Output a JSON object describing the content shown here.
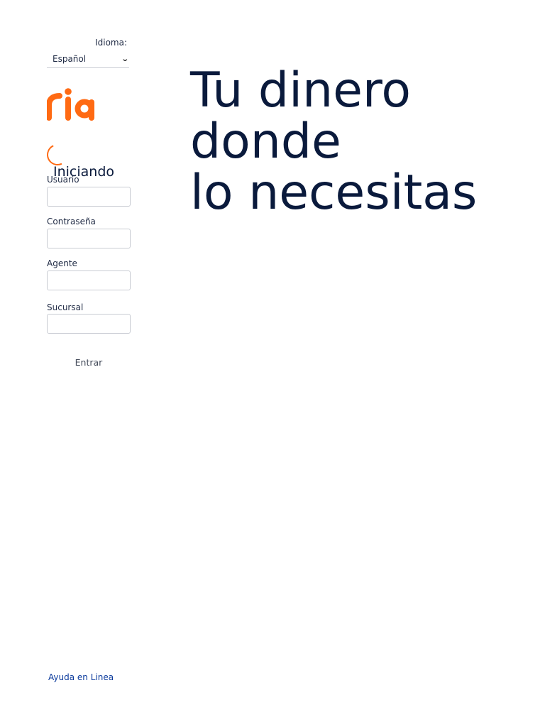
{
  "language": {
    "label": "Idioma:",
    "selected": "Español"
  },
  "brand": {
    "logo_text": "ria",
    "color": "#ff6a13"
  },
  "loading": {
    "text": "Iniciando"
  },
  "form": {
    "username_label": "Usuario",
    "password_label": "Contraseña",
    "agent_label": "Agente",
    "branch_label": "Sucursal",
    "submit_label": "Entrar"
  },
  "hero": {
    "line1": "Tu dinero",
    "line2": "donde",
    "line3": "lo necesitas",
    "color": "#0a1a3c"
  },
  "footer": {
    "help_link": "Ayuda en Linea",
    "link_color": "#0a3a9c"
  }
}
